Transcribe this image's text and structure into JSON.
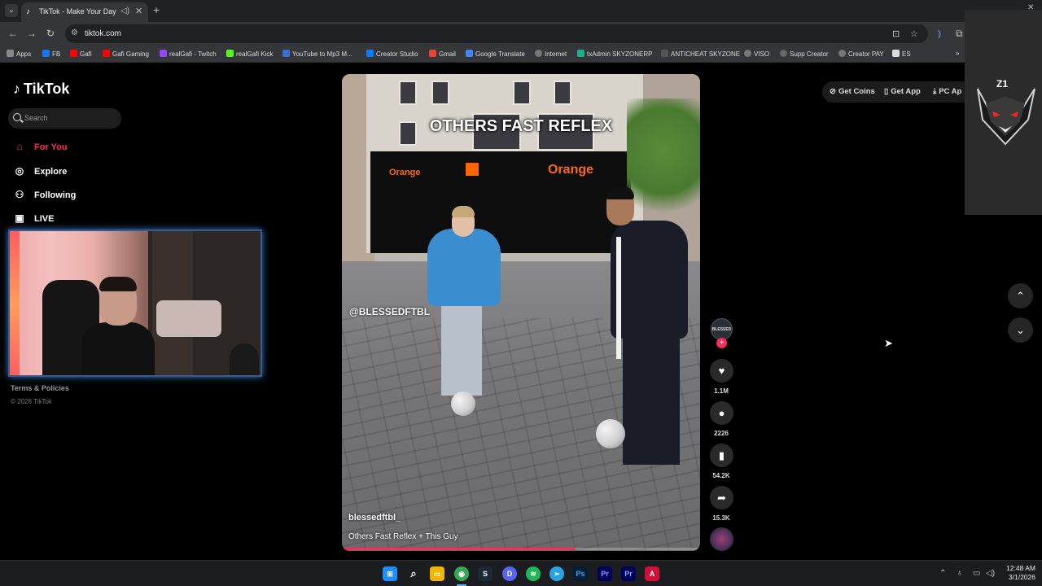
{
  "browser": {
    "tab_title": "TikTok - Make Your Day",
    "url": "tiktok.com",
    "bookmarks": [
      "Apps",
      "FB",
      "Gafi",
      "Gafi Gaming",
      "realGafi - Twitch",
      "realGafi Kick",
      "YouTube to Mp3 M...",
      "Creator Studio",
      "Gmail",
      "Google Translate",
      "Internet",
      "txAdmin SKYZONERP",
      "ANTICHEAT SKYZONE",
      "VISO",
      "Supp Creator",
      "Creator PAY",
      "ES"
    ]
  },
  "sidebar": {
    "logo": "TikTok",
    "search_placeholder": "Search",
    "nav": [
      {
        "label": "For You",
        "icon": "home-icon",
        "active": true
      },
      {
        "label": "Explore",
        "icon": "compass-icon",
        "active": false
      },
      {
        "label": "Following",
        "icon": "following-icon",
        "active": false
      },
      {
        "label": "LIVE",
        "icon": "live-icon",
        "active": false
      }
    ],
    "terms": "Terms & Policies",
    "copyright": "© 2026 TikTok"
  },
  "video": {
    "overlay_title": "OTHERS FAST REFLEX",
    "overlay_handle": "@BLESSEDFTBL",
    "author": "blessedftbl_",
    "description": "Others Fast Reflex + This Guy",
    "store_sign": "Orange",
    "progress": 0.65
  },
  "actions": {
    "avatar_text": "BLESSED",
    "likes": "1.1M",
    "comments": "2226",
    "saves": "54.2K",
    "shares": "15.3K"
  },
  "top_actions": {
    "get_coins": "Get Coins",
    "get_app": "Get App",
    "pc_app": "PC Ap"
  },
  "overlay_logo": "Z1",
  "taskbar": {
    "time": "12:48 AM",
    "date": "3/1/2026"
  },
  "colors": {
    "accent": "#fe2c55",
    "background": "#000000"
  }
}
